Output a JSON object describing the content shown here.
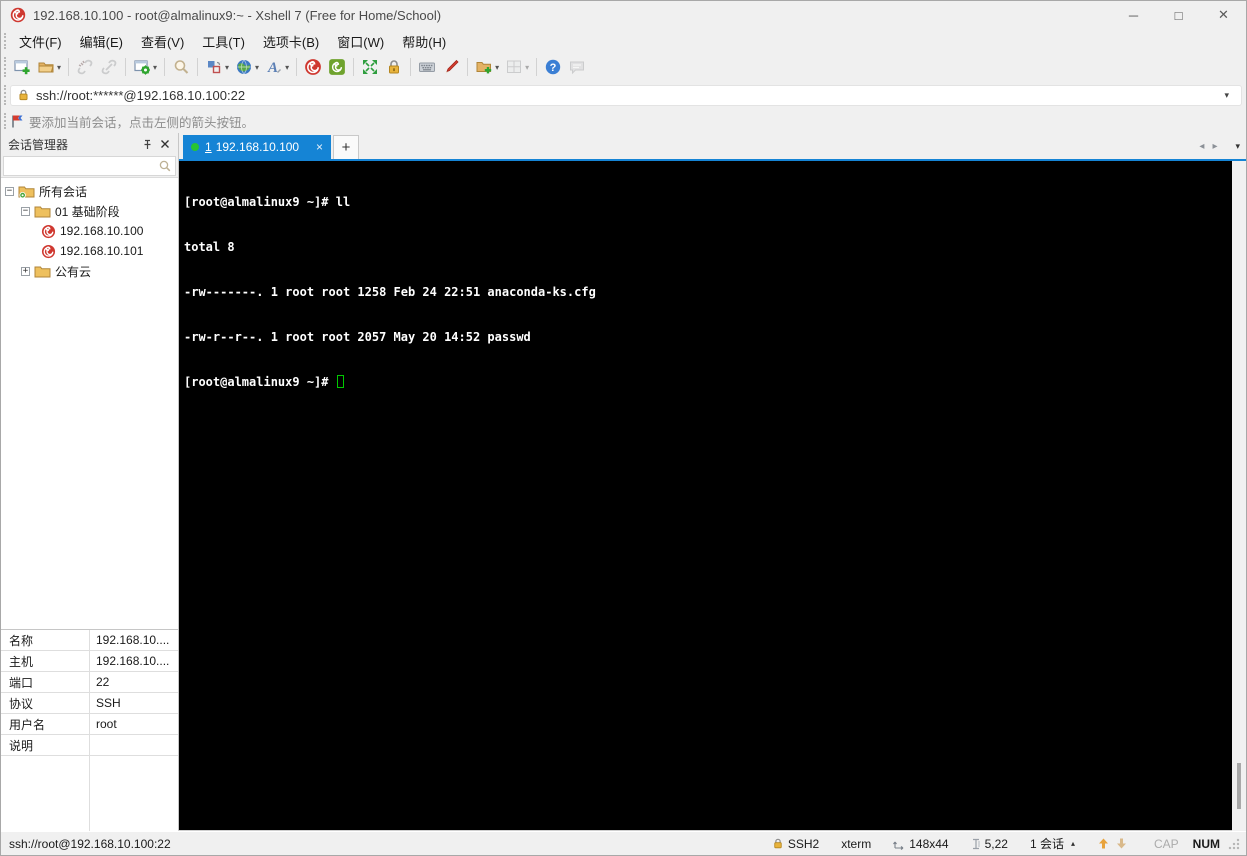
{
  "window": {
    "title": "192.168.10.100 - root@almalinux9:~ - Xshell 7 (Free for Home/School)",
    "controls": {
      "minimize": "─",
      "maximize": "□",
      "close": "✕"
    }
  },
  "menu": {
    "items": [
      {
        "label": "文件(F)"
      },
      {
        "label": "编辑(E)"
      },
      {
        "label": "查看(V)"
      },
      {
        "label": "工具(T)"
      },
      {
        "label": "选项卡(B)"
      },
      {
        "label": "窗口(W)"
      },
      {
        "label": "帮助(H)"
      }
    ]
  },
  "toolbar": {
    "icons": [
      "new-session",
      "open-session",
      "disconnect",
      "reconnect",
      "session-properties",
      "find",
      "compose-layout",
      "web-launch",
      "font",
      "xshell",
      "xftp",
      "fullscreen",
      "lock-screen",
      "virtual-keyboard",
      "highlight",
      "new-file",
      "tile-layout",
      "help",
      "message"
    ]
  },
  "address_bar": {
    "value": "ssh://root:******@192.168.10.100:22"
  },
  "info_bar": {
    "text": "要添加当前会话，点击左侧的箭头按钮。"
  },
  "session_manager": {
    "title": "会话管理器",
    "search_placeholder": "",
    "tree": [
      {
        "label": "所有会话"
      },
      {
        "label": "01 基础阶段"
      },
      {
        "label": "192.168.10.100"
      },
      {
        "label": "192.168.10.101"
      },
      {
        "label": "公有云"
      }
    ]
  },
  "tabs": {
    "scroll_left": "◂",
    "scroll_right": "▸",
    "list_dropdown": "▾",
    "new_tab_label": "+",
    "active": {
      "number": "1",
      "label": "192.168.10.100",
      "close": "×"
    }
  },
  "terminal": {
    "lines": [
      "[root@almalinux9 ~]# ll",
      "total 8",
      "-rw-------. 1 root root 1258 Feb 24 22:51 anaconda-ks.cfg",
      "-rw-r--r--. 1 root root 2057 May 20 14:52 passwd"
    ],
    "prompt": "[root@almalinux9 ~]# "
  },
  "properties": {
    "rows": [
      {
        "label": "名称",
        "value": "192.168.10...."
      },
      {
        "label": "主机",
        "value": "192.168.10...."
      },
      {
        "label": "端口",
        "value": "22"
      },
      {
        "label": "协议",
        "value": "SSH"
      },
      {
        "label": "用户名",
        "value": "root"
      },
      {
        "label": "说明",
        "value": ""
      }
    ]
  },
  "status_bar": {
    "left": "ssh://root@192.168.10.100:22",
    "protocol": "SSH2",
    "term_type": "xterm",
    "size": "148x44",
    "cursor_pos": "5,22",
    "session_count": "1 会话",
    "cap": "CAP",
    "num": "NUM"
  },
  "colors": {
    "accent_blue": "#1584d5",
    "chrome_bg": "#f0f0f0",
    "terminal_bg": "#000000",
    "terminal_fg": "#ffffff",
    "cursor_green": "#00c800",
    "xshell_red": "#cf3830",
    "tab_dot_green": "#28c432",
    "folder_yellow": "#eec05e"
  }
}
